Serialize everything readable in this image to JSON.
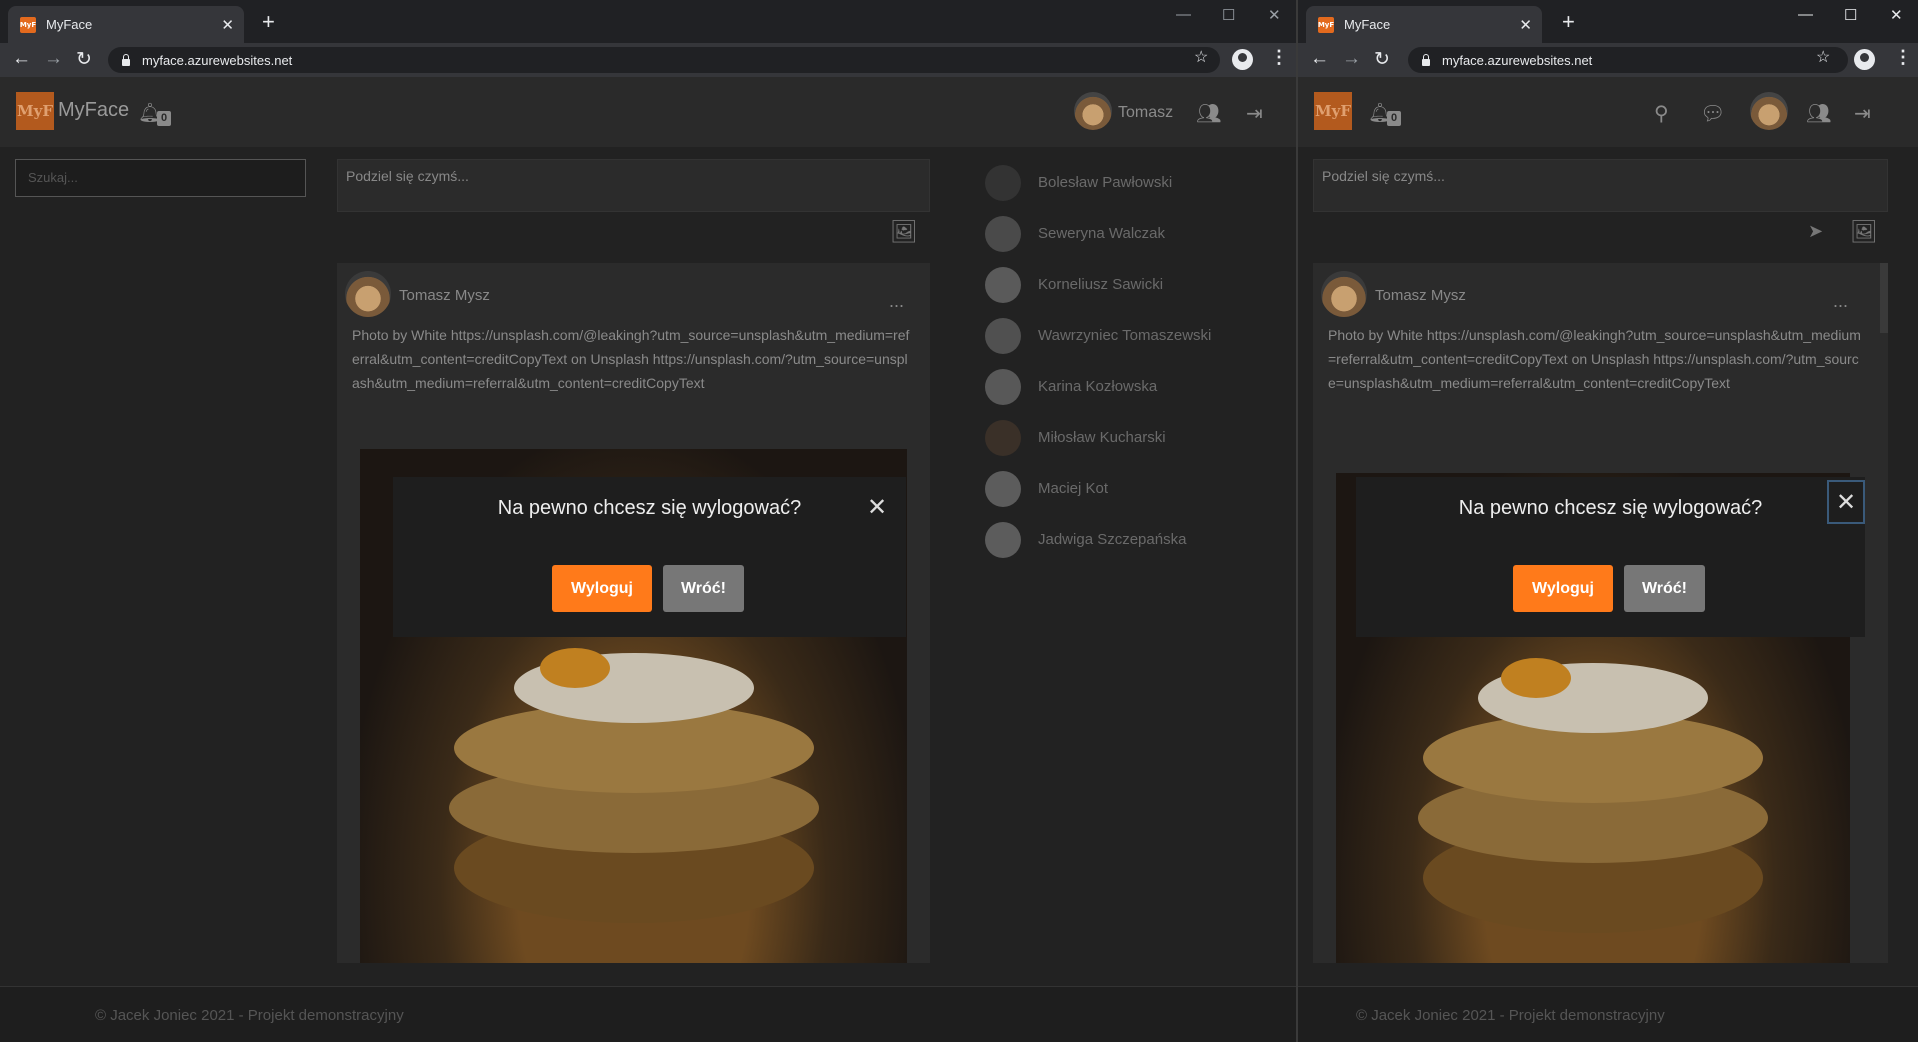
{
  "left_window": {
    "tab_title": "MyFace",
    "favicon_text": "MyF",
    "url": "myface.azurewebsites.net",
    "brand": "MyFace",
    "logo_text": "MyF",
    "notif_count": "0",
    "user_name": "Tomasz",
    "search_placeholder": "Szukaj...",
    "share_placeholder": "Podziel się czymś...",
    "post": {
      "author": "Tomasz Mysz",
      "more": "...",
      "text": "Photo by White https://unsplash.com/@leakingh?utm_source=unsplash&utm_medium=referral&utm_content=creditCopyText on Unsplash https://unsplash.com/?utm_source=unsplash&utm_medium=referral&utm_content=creditCopyText"
    },
    "friends": [
      {
        "name": "Bolesław Pawłowski"
      },
      {
        "name": "Seweryna Walczak"
      },
      {
        "name": "Korneliusz Sawicki"
      },
      {
        "name": "Wawrzyniec Tomaszewski"
      },
      {
        "name": "Karina Kozłowska"
      },
      {
        "name": "Miłosław Kucharski"
      },
      {
        "name": "Maciej Kot"
      },
      {
        "name": "Jadwiga Szczepańska"
      }
    ],
    "footer": "© Jacek Joniec 2021 - Projekt demonstracyjny",
    "modal": {
      "title": "Na pewno chcesz się wylogować?",
      "confirm": "Wyloguj",
      "cancel": "Wróć!",
      "close": "✕"
    }
  },
  "right_window": {
    "tab_title": "MyFace",
    "favicon_text": "MyF",
    "url": "myface.azurewebsites.net",
    "logo_text": "MyF",
    "notif_count": "0",
    "share_placeholder": "Podziel się czymś...",
    "post": {
      "author": "Tomasz Mysz",
      "more": "...",
      "text": "Photo by White https://unsplash.com/@leakingh?utm_source=unsplash&utm_medium=referral&utm_content=creditCopyText on Unsplash https://unsplash.com/?utm_source=unsplash&utm_medium=referral&utm_content=creditCopyText"
    },
    "footer": "© Jacek Joniec 2021 - Projekt demonstracyjny",
    "modal": {
      "title": "Na pewno chcesz się wylogować?",
      "confirm": "Wyloguj",
      "cancel": "Wróć!",
      "close": "✕"
    }
  },
  "colors": {
    "accent_orange": "#ff7a1a",
    "secondary_gray": "#777777",
    "brand_logo": "#b35a1e"
  }
}
